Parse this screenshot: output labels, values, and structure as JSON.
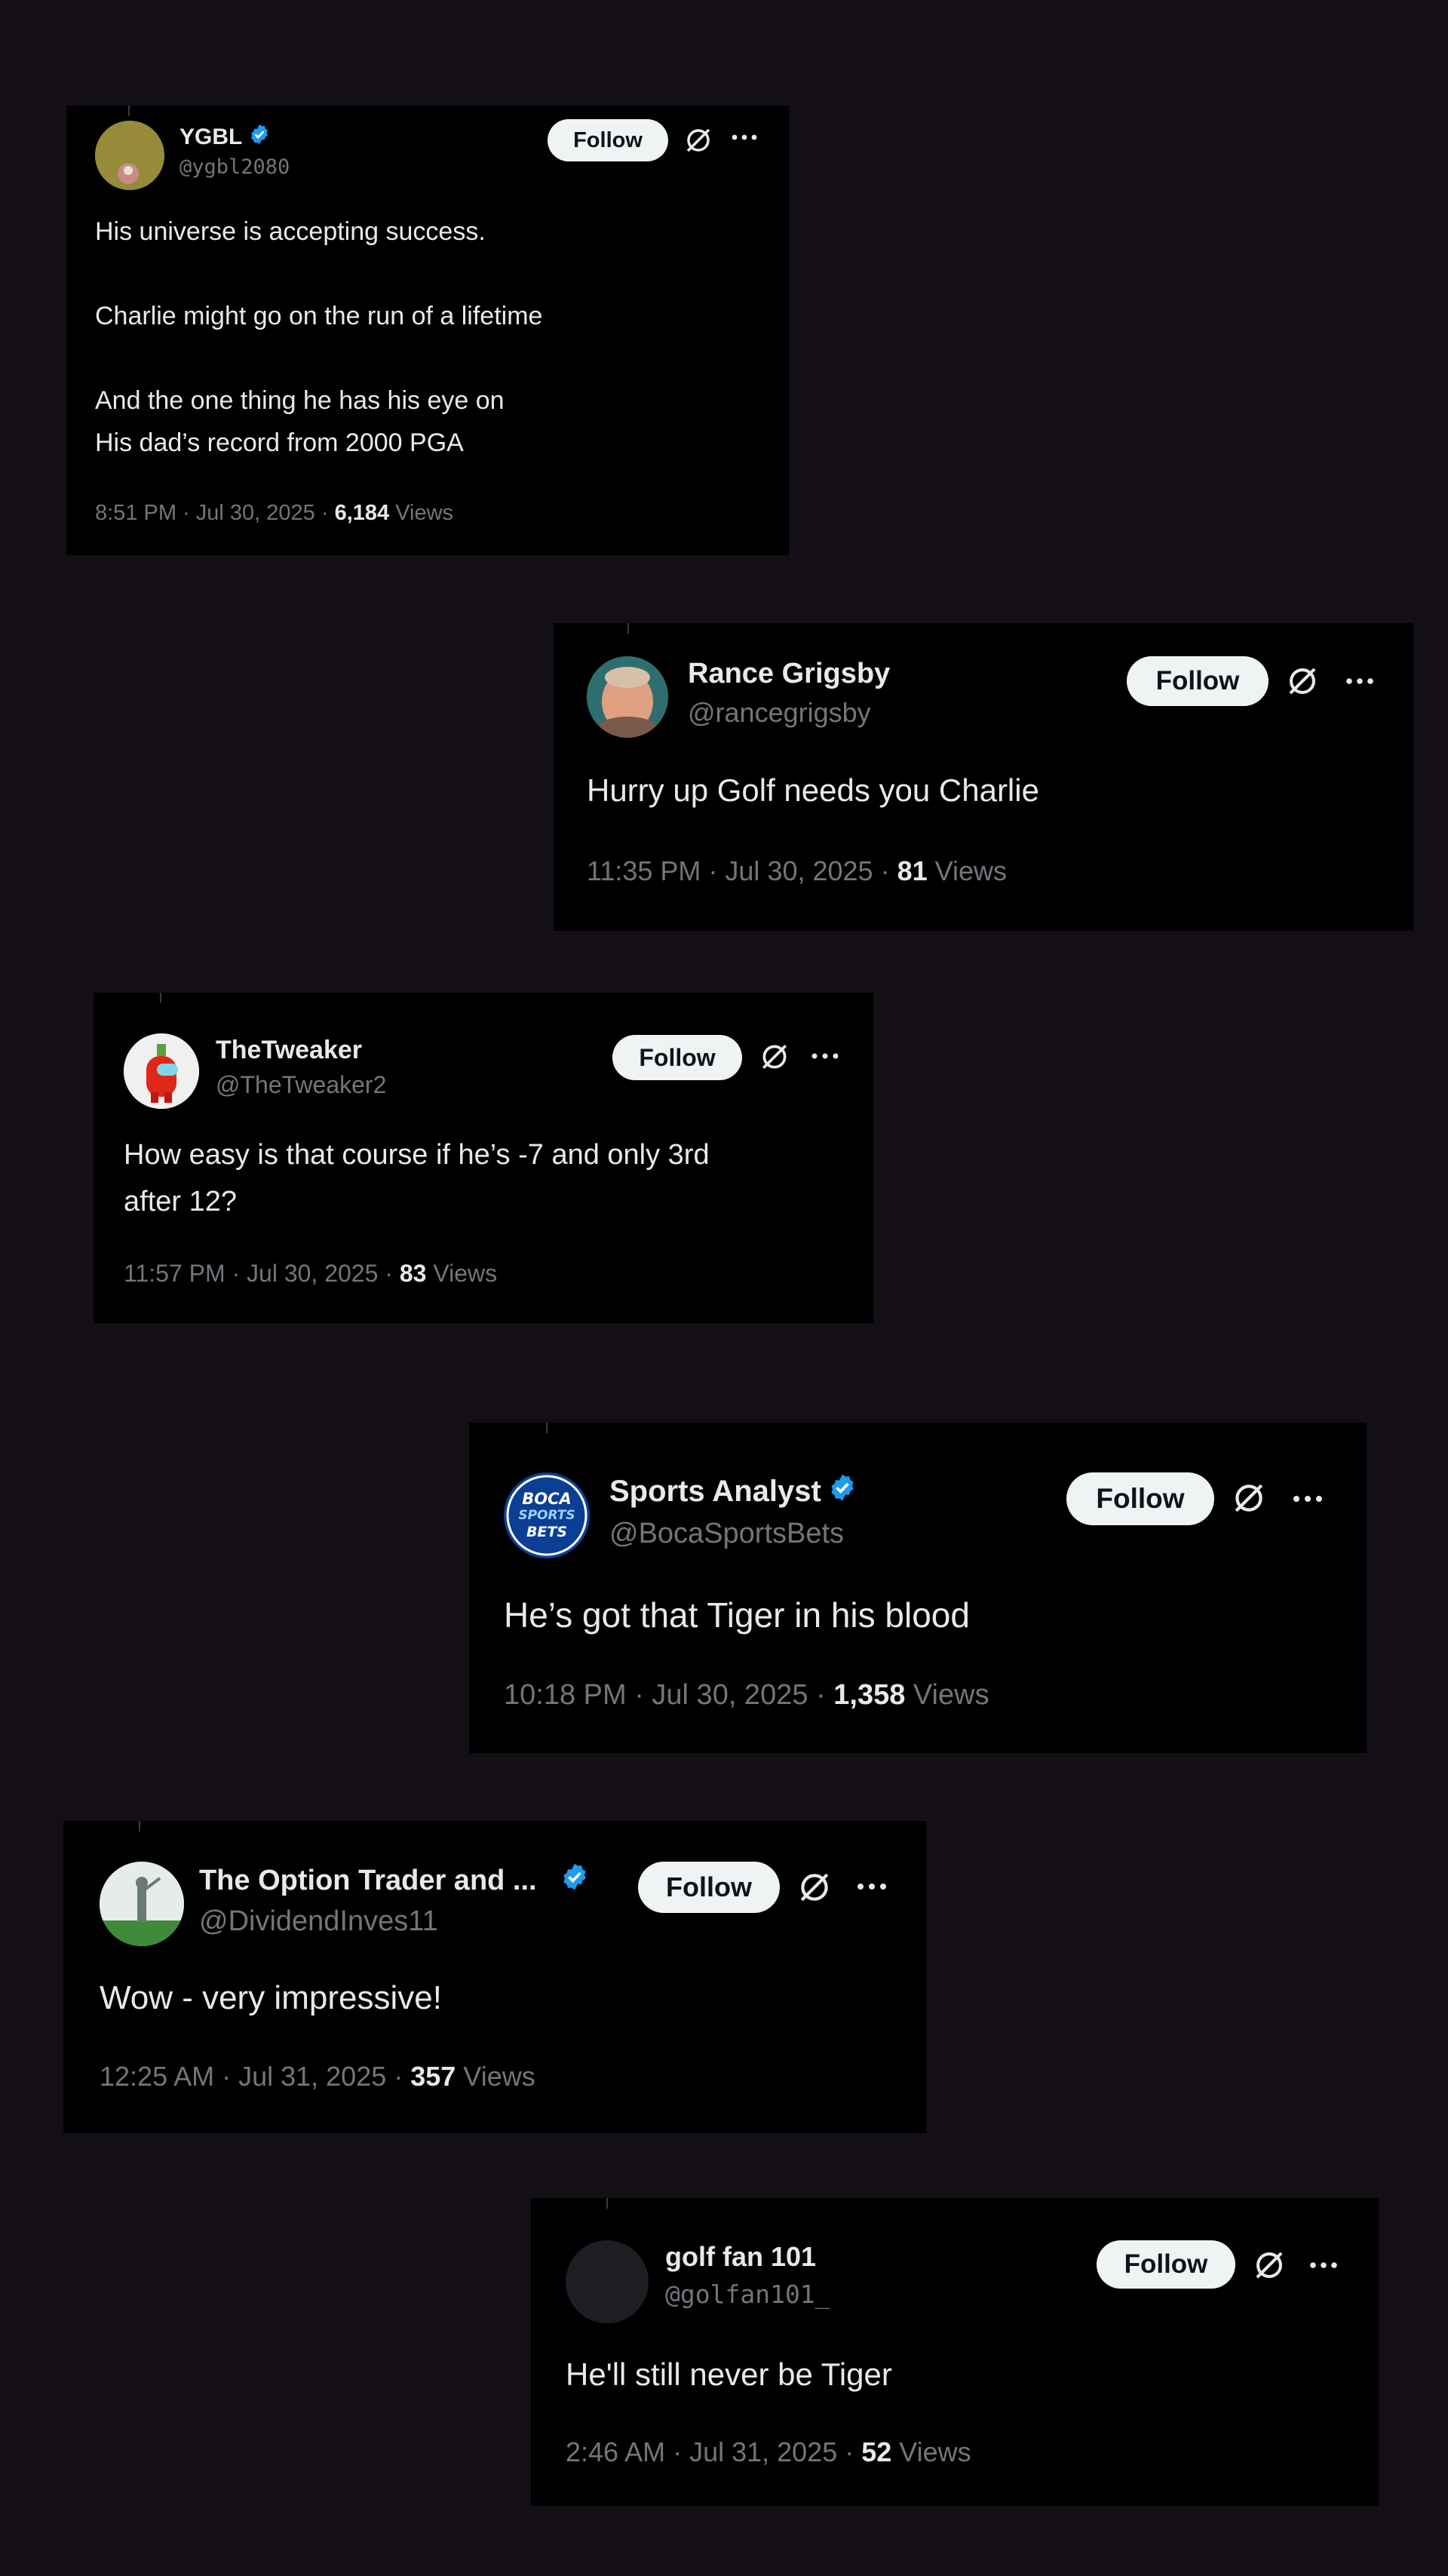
{
  "colors": {
    "page_background": "#140f16",
    "card_background": "#000000",
    "text_primary": "#e7e9ea",
    "text_secondary": "#71767b",
    "verified_blue": "#1d9bf0",
    "follow_button_bg": "#eff3f4"
  },
  "icons": {
    "verified": "verified-badge-icon",
    "grok": "grok-icon",
    "more": "more-options-icon"
  },
  "posts": [
    {
      "name": "YGBL",
      "handle": "@ygbl2080",
      "verified": true,
      "follow_label": "Follow",
      "lines": [
        "His universe is accepting success.",
        "Charlie might go on the run of a lifetime",
        "And the one thing he has his eye on",
        "His dad’s record from 2000 PGA"
      ],
      "time": "8:51 PM · Jul 30, 2025 · ",
      "views_count": "6,184",
      "views_label": " Views"
    },
    {
      "name": "Rance Grigsby",
      "handle": "@rancegrigsby",
      "verified": false,
      "follow_label": "Follow",
      "lines": [
        "Hurry up Golf needs you Charlie"
      ],
      "time": "11:35 PM · Jul 30, 2025 · ",
      "views_count": "81",
      "views_label": " Views"
    },
    {
      "name": "TheTweaker",
      "handle": "@TheTweaker2",
      "verified": false,
      "follow_label": "Follow",
      "lines": [
        "How easy is that course if he’s -7 and only 3rd",
        "after 12?"
      ],
      "time": "11:57 PM · Jul 30, 2025 · ",
      "views_count": "83",
      "views_label": " Views"
    },
    {
      "name": "Sports Analyst",
      "handle": "@BocaSportsBets",
      "verified": true,
      "follow_label": "Follow",
      "lines": [
        "He’s got that Tiger in his blood"
      ],
      "time": "10:18 PM · Jul 30, 2025 · ",
      "views_count": "1,358",
      "views_label": " Views",
      "avatar_text": [
        "BOCA",
        "SPORTS",
        "BETS"
      ]
    },
    {
      "name": "The Option Trader and ...",
      "handle": "@DividendInves11",
      "verified": true,
      "follow_label": "Follow",
      "lines": [
        "Wow - very impressive!"
      ],
      "time": "12:25 AM · Jul 31, 2025 · ",
      "views_count": "357",
      "views_label": " Views"
    },
    {
      "name": "golf fan 101",
      "handle": "@golfan101_",
      "verified": false,
      "follow_label": "Follow",
      "lines": [
        "He'll still never be Tiger"
      ],
      "time": "2:46 AM · Jul 31, 2025 · ",
      "views_count": "52",
      "views_label": " Views"
    }
  ]
}
